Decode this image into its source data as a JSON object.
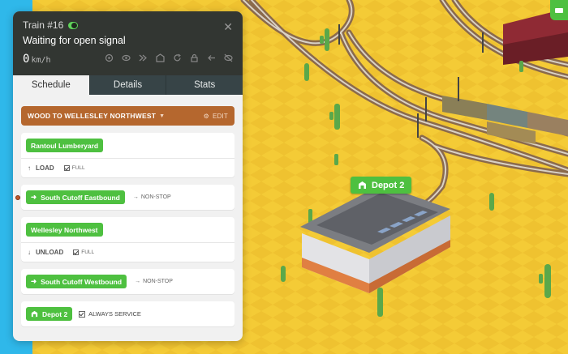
{
  "train": {
    "title": "Train #16",
    "status": "Waiting for open signal",
    "speed_value": "0",
    "speed_unit": "km/h",
    "header_icons": [
      "target-icon",
      "eye-icon",
      "fast-forward-icon",
      "depot-icon",
      "refresh-icon",
      "lock-icon",
      "reverse-icon",
      "hide-icon"
    ]
  },
  "tabs": [
    "Schedule",
    "Details",
    "Stats"
  ],
  "route": {
    "name": "WOOD TO WELLESLEY NORTHWEST",
    "edit_label": "EDIT"
  },
  "stops": [
    {
      "name": "Rantoul Lumberyard",
      "action": "LOAD",
      "option": "FULL"
    },
    {
      "name": "South Cutoff Eastbound",
      "mode": "NON-STOP"
    },
    {
      "name": "Wellesley Northwest",
      "action": "UNLOAD",
      "option": "FULL"
    },
    {
      "name": "South Cutoff Westbound",
      "mode": "NON-STOP"
    },
    {
      "name": "Depot 2",
      "option": "ALWAYS SERVICE"
    }
  ],
  "map": {
    "depot_label": "Depot 2"
  },
  "colors": {
    "accent_green": "#4ec040",
    "route_brown": "#b5672e",
    "ground_yellow": "#f2c833",
    "water_blue": "#27b3e6"
  }
}
